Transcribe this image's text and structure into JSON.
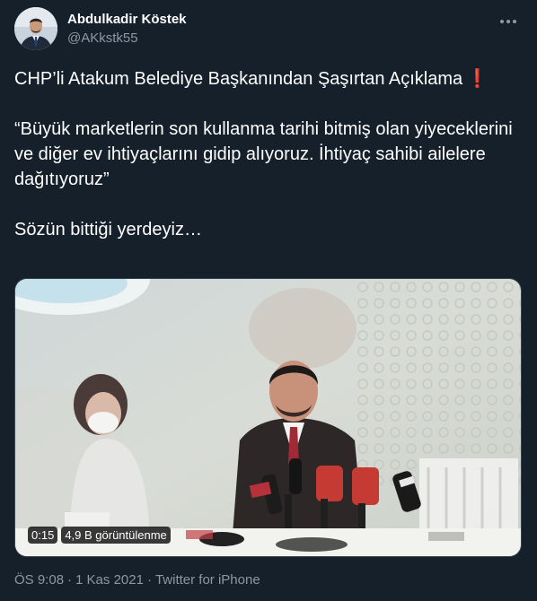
{
  "author": {
    "display_name": "Abdulkadir Köstek",
    "handle": "@AKkstk55",
    "avatar_icon": "profile-photo"
  },
  "menu": {
    "icon": "more-horizontal-icon"
  },
  "tweet": {
    "title_line": "CHP’li Atakum Belediye Başkanından Şaşırtan Açıklama",
    "title_emoji": "❗",
    "quote": "“Büyük marketlerin son kullanma tarihi bitmiş olan yiyeceklerini ve diğer ev ihtiyaçlarını gidip alıyoruz. İhtiyaç sahibi ailelere dağıtıyoruz”",
    "closing": "Sözün bittiği yerdeyiz…"
  },
  "video": {
    "duration": "0:15",
    "views": "4,9 B görüntülenme"
  },
  "meta": {
    "time": "ÖS 9:08",
    "separator": "·",
    "date": "1 Kas 2021",
    "source": "Twitter for iPhone"
  },
  "colors": {
    "background": "#15202b",
    "secondary_text": "#8b98a5",
    "exclamation": "#d9273e"
  }
}
